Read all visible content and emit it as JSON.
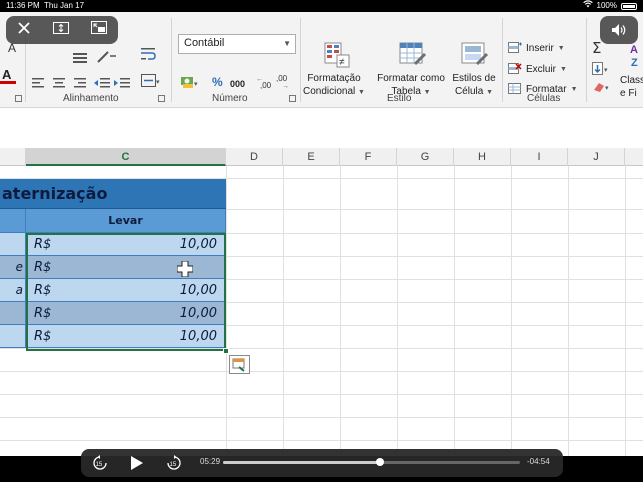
{
  "status_bar": {
    "time": "11:36 PM",
    "date": "Thu Jan 17",
    "battery": "100%"
  },
  "ribbon": {
    "number_format": "Contábil",
    "groups": {
      "alignment": "Alinhamento",
      "number": "Número",
      "style": "Estilo",
      "cells": "Células"
    },
    "style_buttons": [
      {
        "line1": "Formatação",
        "line2": "Condicional"
      },
      {
        "line1": "Formatar como",
        "line2": "Tabela"
      },
      {
        "line1": "Estilos de",
        "line2": "Célula"
      }
    ],
    "cells_buttons": [
      "Inserir",
      "Excluir",
      "Formatar"
    ],
    "editing_partial": {
      "line1": "Class",
      "line2": "e Fi"
    },
    "percent": "%",
    "thousands": "000",
    "dec_inc": "⁺⁰",
    "dec_dec": "⁰₀"
  },
  "columns": [
    "C",
    "D",
    "E",
    "F",
    "G",
    "H",
    "I",
    "J"
  ],
  "sheet": {
    "title": "aternização",
    "header_c": "Levar",
    "rows": [
      {
        "b": "",
        "currency": "R$",
        "amount": "10,00"
      },
      {
        "b": "e",
        "currency": "R$",
        "amount": ""
      },
      {
        "b": "a",
        "currency": "R$",
        "amount": "10,00"
      },
      {
        "b": "",
        "currency": "R$",
        "amount": "10,00"
      },
      {
        "b": "",
        "currency": "R$",
        "amount": "10,00"
      }
    ]
  },
  "player": {
    "elapsed": "05:29",
    "remaining": "-04:54",
    "progress": 0.53,
    "skip_back": "15",
    "skip_forward": "15"
  }
}
